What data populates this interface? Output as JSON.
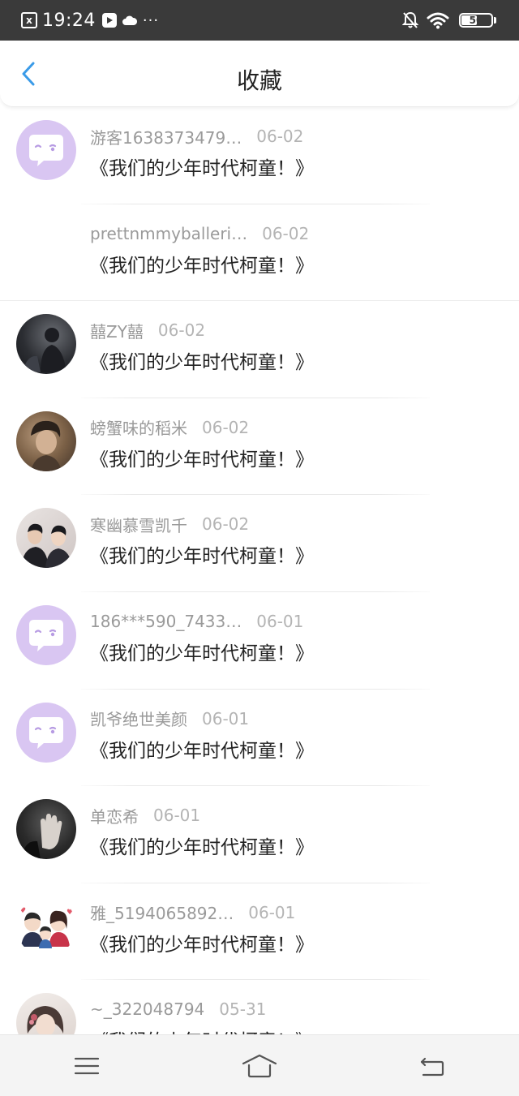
{
  "status_bar": {
    "time": "19:24",
    "notification_icon_label": "x",
    "battery_level": "50",
    "dots": "···"
  },
  "header": {
    "title": "收藏"
  },
  "items": [
    {
      "name": "游客1638373479…",
      "date": "06-02",
      "title": "《我们的少年时代柯童！》",
      "avatar": "chat-bubble"
    },
    {
      "name": "prettnmmyballeri…",
      "date": "06-02",
      "title": "《我们的少年时代柯童！》",
      "avatar": "none"
    },
    {
      "name": "囍ZY囍",
      "date": "06-02",
      "title": "《我们的少年时代柯童！》",
      "avatar": "photo-dark"
    },
    {
      "name": "螃蟹味的稻米",
      "date": "06-02",
      "title": "《我们的少年时代柯童！》",
      "avatar": "photo-brown"
    },
    {
      "name": "寒幽慕雪凯千",
      "date": "06-02",
      "title": "《我们的少年时代柯童！》",
      "avatar": "photo-duo"
    },
    {
      "name": "186***590_7433…",
      "date": "06-01",
      "title": "《我们的少年时代柯童！》",
      "avatar": "chat-bubble"
    },
    {
      "name": "凯爷绝世美颜",
      "date": "06-01",
      "title": "《我们的少年时代柯童！》",
      "avatar": "chat-bubble"
    },
    {
      "name": "单恋希",
      "date": "06-01",
      "title": "《我们的少年时代柯童！》",
      "avatar": "photo-hand"
    },
    {
      "name": "雅_5194065892…",
      "date": "06-01",
      "title": "《我们的少年时代柯童！》",
      "avatar": "cartoon-family"
    },
    {
      "name": "~_322048794",
      "date": "05-31",
      "title": "《我们的少年时代柯童！》",
      "avatar": "photo-girl"
    }
  ],
  "colors": {
    "accent": "#3a9be8",
    "avatar_bubble_bg": "#d9c6f2",
    "status_bar_bg": "#3a3a3a"
  }
}
